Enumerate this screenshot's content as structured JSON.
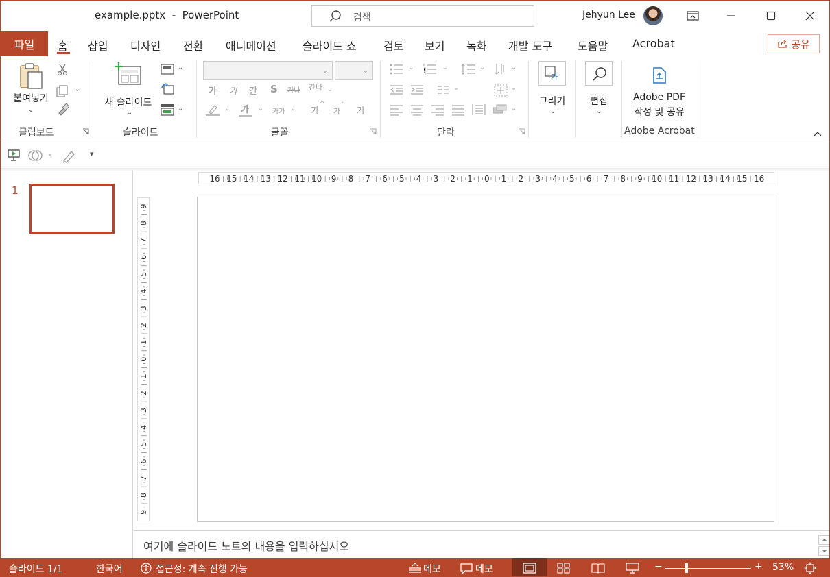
{
  "titlebar": {
    "file_name": "example.pptx",
    "separator": "-",
    "app_name": "PowerPoint",
    "search_placeholder": "검색",
    "user_name": "Jehyun Lee"
  },
  "tabs": {
    "file": "파일",
    "items": [
      "홈",
      "삽입",
      "디자인",
      "전환",
      "애니메이션",
      "슬라이드 쇼",
      "검토",
      "보기",
      "녹화",
      "개발 도구",
      "도움말",
      "Acrobat"
    ],
    "active": "홈",
    "share": "공유"
  },
  "ribbon": {
    "clipboard": {
      "paste": "붙여넣기",
      "label": "클립보드"
    },
    "slides": {
      "new_slide": "새 슬라이드",
      "label": "슬라이드"
    },
    "font": {
      "label": "글꼴",
      "bold": "가",
      "italic": "가",
      "underline": "간",
      "strike": "S",
      "strike_label": "가나",
      "spacing": "간나",
      "highlight": "가",
      "case": "가가",
      "grow": "가",
      "shrink": "가",
      "clear": "가"
    },
    "paragraph": {
      "label": "단락"
    },
    "drawing": {
      "label": "그리기",
      "icon_text": "가"
    },
    "editing": {
      "label": "편집"
    },
    "acrobat": {
      "line1": "Adobe PDF",
      "line2": "작성 및 공유",
      "label": "Adobe Acrobat"
    }
  },
  "ruler": {
    "horizontal": [
      "16",
      "15",
      "14",
      "13",
      "12",
      "11",
      "10",
      "9",
      "8",
      "7",
      "6",
      "5",
      "4",
      "3",
      "2",
      "1",
      "0",
      "1",
      "2",
      "3",
      "4",
      "5",
      "6",
      "7",
      "8",
      "9",
      "10",
      "11",
      "12",
      "13",
      "14",
      "15",
      "16"
    ],
    "vertical": [
      "9",
      "8",
      "7",
      "6",
      "5",
      "4",
      "3",
      "2",
      "1",
      "0",
      "1",
      "2",
      "3",
      "4",
      "5",
      "6",
      "7",
      "8",
      "9"
    ]
  },
  "thumbnails": {
    "number": "1"
  },
  "notes": {
    "placeholder": "여기에 슬라이드 노트의 내용을 입력하십시오"
  },
  "status": {
    "slide": "슬라이드 1/1",
    "language": "한국어",
    "accessibility": "접근성: 계속 진행 가능",
    "notes": "메모",
    "comments": "메모",
    "zoom": "53%",
    "zoom_minus": "−",
    "zoom_plus": "+"
  },
  "colors": {
    "accent": "#b7472a",
    "accent_dark": "#7d2f1b",
    "ribbon_icon_blue": "#2b78c2"
  }
}
